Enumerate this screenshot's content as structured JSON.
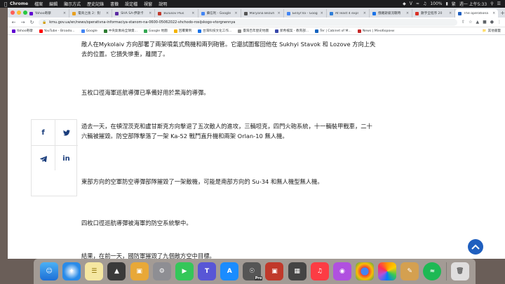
{
  "menubar": {
    "app_name": "Chrome",
    "items": [
      "檔案",
      "編輯",
      "顯示方式",
      "歷史記錄",
      "書籤",
      "設定檔",
      "視窗",
      "說明"
    ],
    "status_text": "100%",
    "input_method": "繁",
    "clock": "週一 上午5:33"
  },
  "tabs": [
    {
      "label": "Yahoo奇摩",
      "color": "#6001d2"
    },
    {
      "label": "電商之後 2：對",
      "color": "#e8a020"
    },
    {
      "label": "SHA SA-伊斯卡",
      "color": "#5b2aa3"
    },
    {
      "label": "Bulusov Plus",
      "color": "#c0392b"
    },
    {
      "label": "攝信利 - Google",
      "color": "#4285f4"
    },
    {
      "label": "Maryana Bezuh",
      "color": "#555555"
    },
    {
      "label": "Безугла - Goog",
      "color": "#4285f4"
    },
    {
      "label": "At least 4 expl",
      "color": "#2e7dd7"
    },
    {
      "label": "俄羅斯緩流戰時",
      "color": "#1a73e8"
    },
    {
      "label": "數字全程序 20",
      "color": "#d93025"
    },
    {
      "label": "The operationa",
      "color": "#1f5fbf"
    }
  ],
  "address_bar": {
    "url": "kmu.gov.ua/en/news/operativna-informaciya-stanom-na-0600-05062022-shchodo-rosijskogo-vtorgnennya"
  },
  "bookmarks": {
    "items": [
      "Yahoo奇摩",
      "YouTube - Broado...",
      "Google",
      "中央氣象局全球資...",
      "Google 地圖",
      "回覆實例",
      "台灣科技文化工作...",
      "臺灣百年歷史地圖",
      "新希檔案 - 教育部...",
      "Ter | Cabinet of M...",
      "News | Міноборони"
    ],
    "colors": [
      "#6001d2",
      "#ff0000",
      "#4285f4",
      "#2e7d32",
      "#34a853",
      "#f4b400",
      "#1a73e8",
      "#888888",
      "#3949ab",
      "#1565c0",
      "#c62828"
    ],
    "other_label": "其他書籤"
  },
  "article": {
    "paragraphs": [
      "敵人在Mykolaiv 方向部署了兩架噴氣式飛機和兩列砲管。它還試圖奪回他在 Sukhyi Stavok 和 Lozove 方向上失去的位置。它損失慘重，離開了。",
      "五枚口徑海軍巡航導彈已準備好用於黑海的導彈。",
      "過去一天，在頓涅茨克和盧甘斯克方向擊退了五次敵人的進攻，三輛坦克，四門火砲系統，十一輛裝甲戰車，二十六輛被摧毀。防空部隊擊落了一架 Ka-52 戰鬥直升機和兩架 Orlan-10 無人機。",
      "東部方向的空軍防空導彈部隊摧毀了一架敵機，可能是南部方向的 Su-34 和無人機型無人機。",
      "四枚口徑巡航導彈被海軍的防空系統擊中。",
      "結果，在前一天，國防軍摧毀了九個敵方空中目標。"
    ]
  },
  "share": {
    "facebook_glyph": "f",
    "linkedin_glyph": "in"
  },
  "dock": {
    "pro_badge": "Pro"
  }
}
